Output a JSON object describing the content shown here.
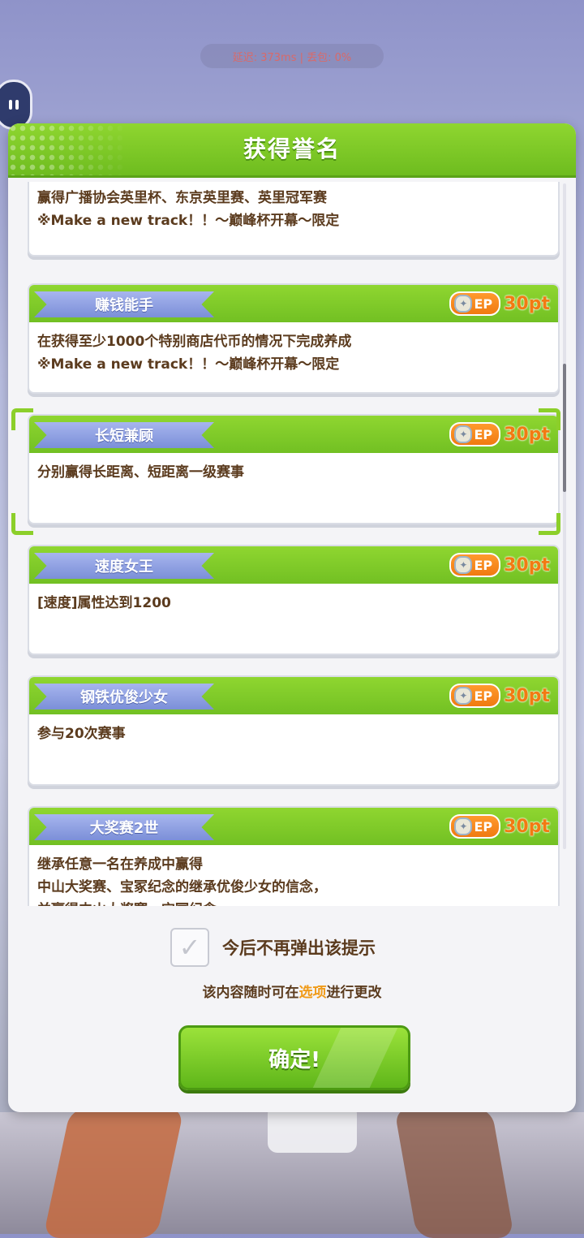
{
  "status_bar": {
    "text": "延迟: 373ms | 丢包: 0%"
  },
  "dialog": {
    "title": "获得誉名",
    "partial_card": {
      "lines": [
        "赢得广播协会英里杯、东京英里赛、英里冠军赛",
        "※Make a new track！！～巅峰杯开幕～限定"
      ]
    },
    "cards": [
      {
        "name": "赚钱能手",
        "ep_label": "EP",
        "points": "30pt",
        "lines": [
          "在获得至少1000个特别商店代币的情况下完成养成",
          "※Make a new track！！～巅峰杯开幕～限定"
        ]
      },
      {
        "name": "长短兼顾",
        "ep_label": "EP",
        "points": "30pt",
        "lines": [
          "分别赢得长距离、短距离一级赛事"
        ]
      },
      {
        "name": "速度女王",
        "ep_label": "EP",
        "points": "30pt",
        "lines": [
          "[速度]属性达到1200"
        ]
      },
      {
        "name": "钢铁优俊少女",
        "ep_label": "EP",
        "points": "30pt",
        "lines": [
          "参与20次赛事"
        ]
      },
      {
        "name": "大奖赛2世",
        "ep_label": "EP",
        "points": "30pt",
        "lines": [
          "继承任意一名在养成中赢得",
          "中山大奖赛、宝冢纪念的继承优俊少女的信念，",
          "并赢得中山大奖赛、宝冢纪念"
        ]
      }
    ],
    "dont_show_label": "今后不再弹出该提示",
    "dont_show_checked": true,
    "hint_prefix": "该内容随时可在",
    "hint_link": "选项",
    "hint_suffix": "进行更改",
    "confirm_label": "确定!"
  },
  "colors": {
    "accent_green": "#7cc628",
    "ribbon_blue": "#8a9de0",
    "points_orange": "#f27a12",
    "text_brown": "#5b3b1e"
  },
  "icons": [
    "chat-bubble-icon",
    "ep-coin-icon",
    "checkmark-icon"
  ]
}
